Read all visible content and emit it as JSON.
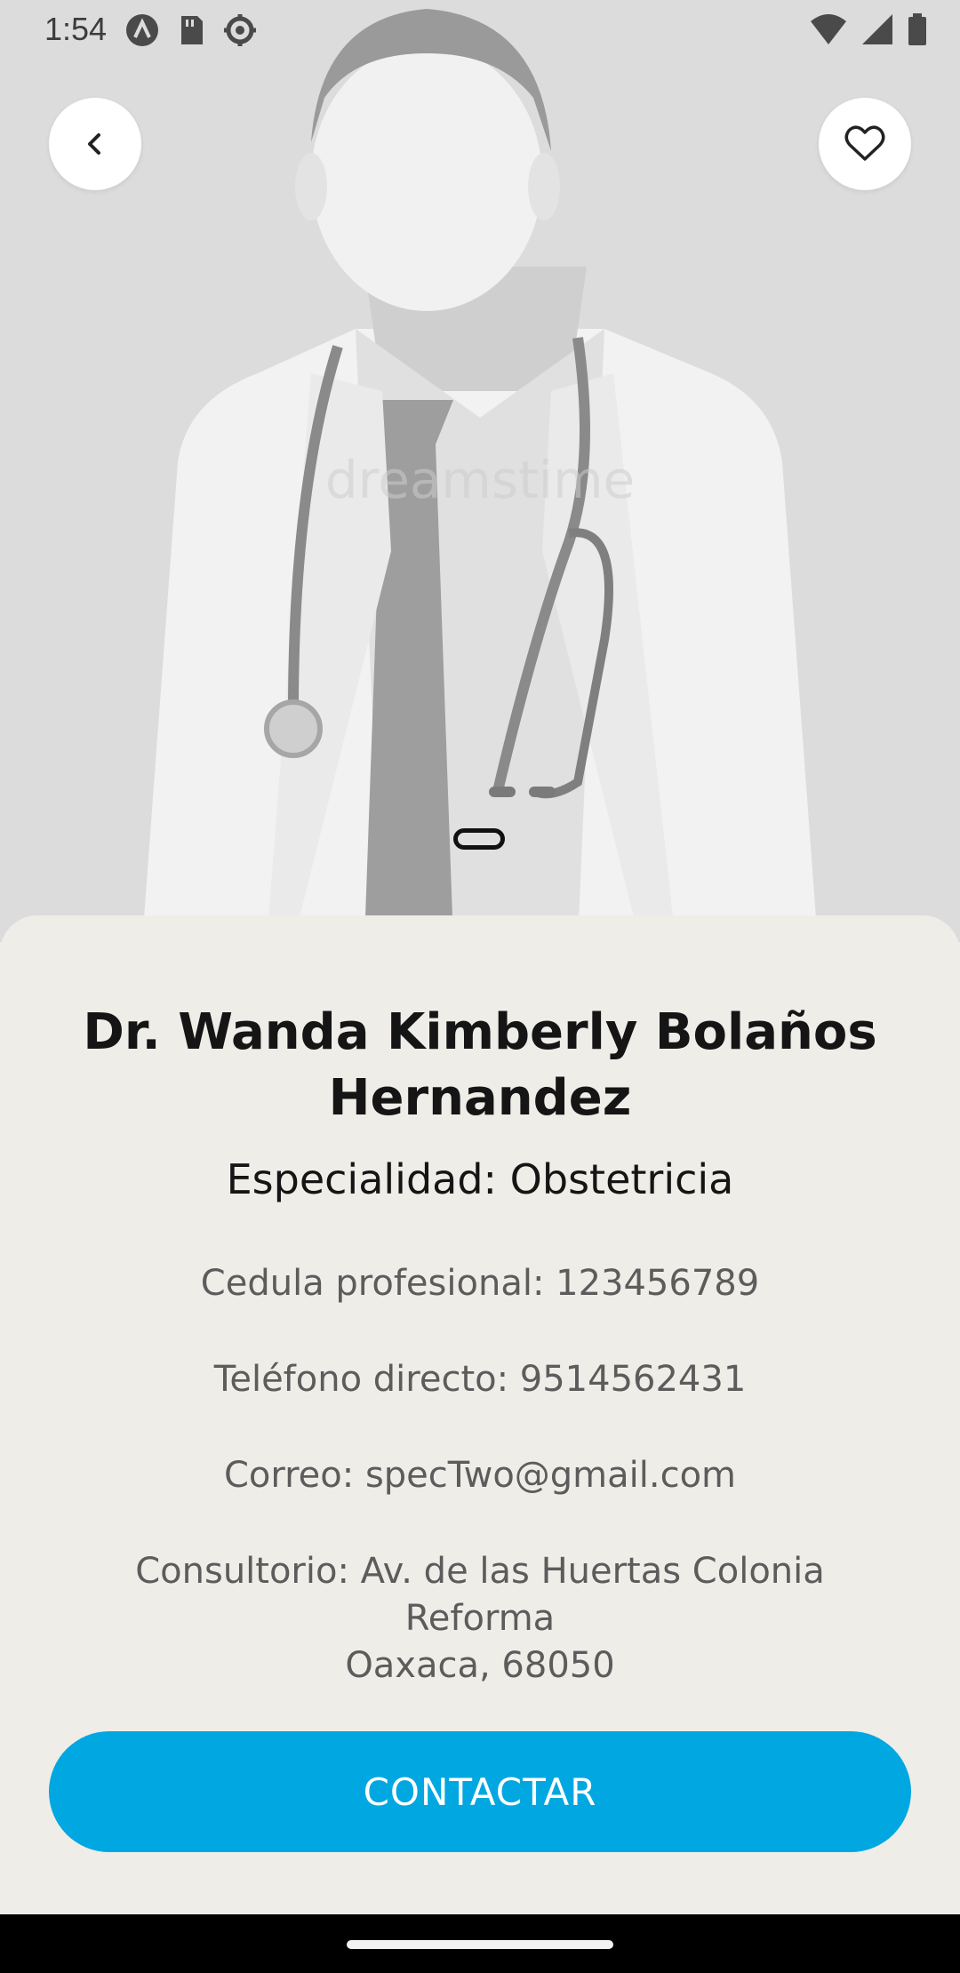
{
  "status_bar": {
    "time": "1:54",
    "icons_left": [
      "a-icon",
      "sd-card-icon",
      "settings-icon"
    ],
    "icons_right": [
      "wifi-icon",
      "signal-icon",
      "battery-icon"
    ]
  },
  "hero": {
    "image": "doctor-placeholder-silhouette",
    "watermark": "dreamstime"
  },
  "buttons": {
    "back_icon": "chevron-left-icon",
    "favorite_icon": "heart-outline-icon",
    "contact_label": "CONTACTAR"
  },
  "doctor": {
    "name": "Dr. Wanda Kimberly Bolaños Hernandez",
    "specialty": "Especialidad: Obstetricia",
    "cedula": "Cedula profesional: 123456789",
    "telefono": "Teléfono directo: 9514562431",
    "correo": "Correo: specTwo@gmail.com",
    "consultorio_line1": "Consultorio:  Av. de las Huertas Colonia",
    "consultorio_line2": "Reforma",
    "consultorio_line3": "Oaxaca, 68050"
  },
  "colors": {
    "accent": "#00a7e1",
    "sheet_background": "#efede8",
    "hero_background": "#dcdcdc"
  }
}
